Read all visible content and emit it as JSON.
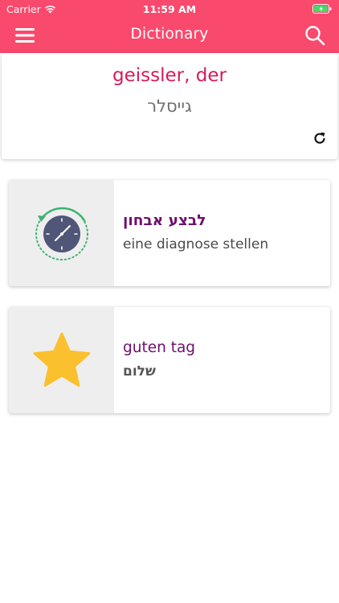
{
  "status_bar": {
    "carrier": "Carrier",
    "time": "11:59 AM"
  },
  "nav": {
    "title": "Dictionary",
    "menu_icon": "hamburger-menu-icon",
    "search_icon": "search-icon"
  },
  "word_of_day": {
    "german": "geissler, der",
    "hebrew": "גייסלר",
    "refresh_icon": "refresh-icon"
  },
  "history_card": {
    "icon": "history-clock-icon",
    "primary": "לבצע אבחון",
    "secondary": "eine diagnose stellen"
  },
  "favorites_card": {
    "icon": "star-icon",
    "primary": "guten tag",
    "secondary": "שלום"
  },
  "colors": {
    "header": "#f9496d",
    "word_german": "#d61a5c",
    "card_primary": "#6f0e6e",
    "star": "#fbc02d",
    "clock_face": "#4f5677",
    "clock_arrow": "#3cb371"
  }
}
